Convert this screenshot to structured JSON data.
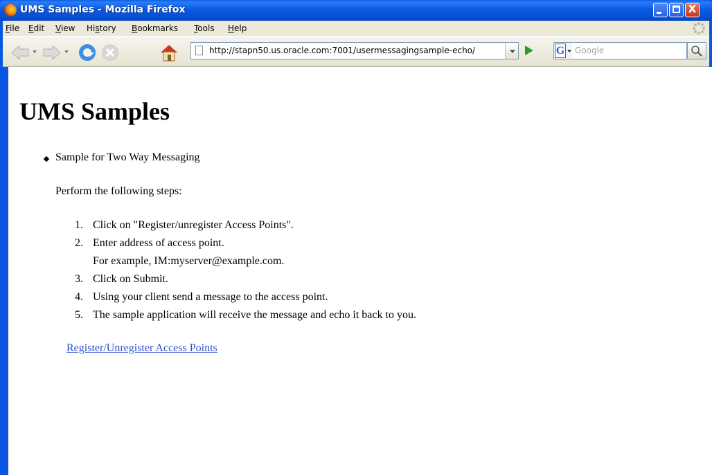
{
  "window": {
    "title": "UMS Samples - Mozilla Firefox",
    "close_glyph": "X"
  },
  "menu": [
    {
      "accel": "F",
      "rest": "ile"
    },
    {
      "accel": "E",
      "rest": "dit"
    },
    {
      "accel": "V",
      "rest": "iew"
    },
    {
      "pre": "Hi",
      "accel": "s",
      "rest": "tory"
    },
    {
      "accel": "B",
      "rest": "ookmarks"
    },
    {
      "accel": "T",
      "rest": "ools"
    },
    {
      "accel": "H",
      "rest": "elp"
    }
  ],
  "toolbar": {
    "url": "http://stapn50.us.oracle.com:7001/usermessagingsample-echo/",
    "search_engine_letter": "G",
    "search_placeholder": "Google"
  },
  "icons": {
    "back": "back-arrow-icon",
    "forward": "forward-arrow-icon",
    "reload": "reload-icon",
    "stop": "stop-icon",
    "home": "home-icon",
    "page": "page-icon",
    "go": "go-arrow-icon",
    "search": "magnifier-icon"
  },
  "page": {
    "title": "UMS Samples",
    "bullet_text": "Sample for Two Way Messaging",
    "intro": "Perform the following steps:",
    "steps": [
      {
        "num": "1.",
        "text": "Click on \"Register/unregister Access Points\"."
      },
      {
        "num": "2.",
        "text": "Enter address of access point.",
        "sub": "For example, IM:myserver@example.com."
      },
      {
        "num": "3.",
        "text": "Click on Submit."
      },
      {
        "num": "4.",
        "text": "Using your client send a message to the access point."
      },
      {
        "num": "5.",
        "text": "The sample application will receive the message and echo it back to you."
      }
    ],
    "link": "Register/Unregister Access Points"
  },
  "colors": {
    "titlebar": "#0a56e2",
    "chrome": "#ece9d8",
    "link": "#2a4bd0",
    "window_border": "#1b56d8"
  }
}
